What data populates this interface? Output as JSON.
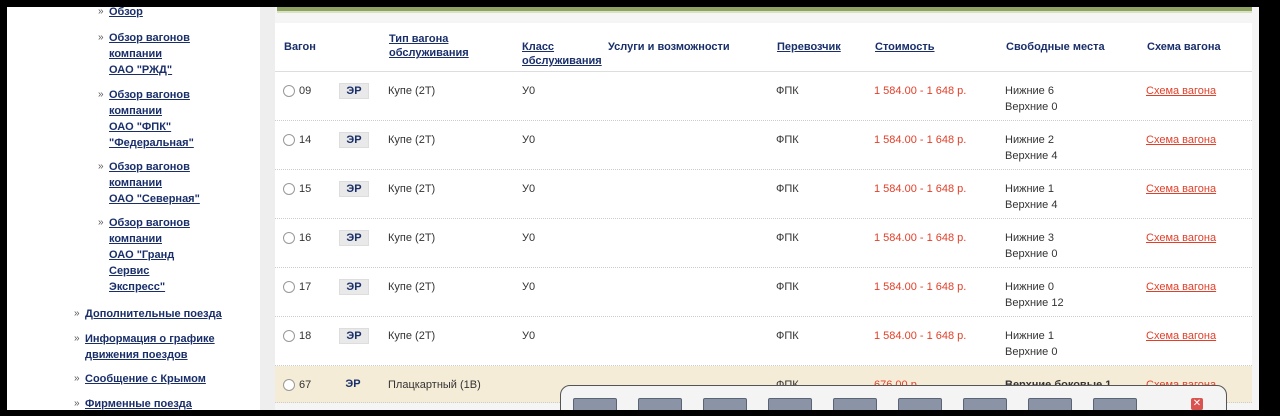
{
  "sidebar": {
    "items": [
      {
        "label": "Обзор",
        "indent": 2
      },
      {
        "label": "Обзор вагонов\nкомпании\nОАО \"РЖД\"",
        "indent": 2
      },
      {
        "label": "Обзор вагонов\nкомпании\nОАО \"ФПК\"\n\"Федеральная\"",
        "indent": 2
      },
      {
        "label": "Обзор вагонов\nкомпании\nОАО \"Северная\"",
        "indent": 2
      },
      {
        "label": "Обзор вагонов\nкомпании\nОАО \"Гранд\nСервис\nЭкспресс\"",
        "indent": 2
      },
      {
        "label": "Дополнительные поезда",
        "indent": 1
      },
      {
        "label": "Информация о графике\nдвижения поездов",
        "indent": 1
      },
      {
        "label": "Сообщение с Крымом",
        "indent": 1
      },
      {
        "label": "Фирменные поезда",
        "indent": 1
      }
    ]
  },
  "table": {
    "headers": {
      "wagon": "Вагон",
      "type": "Тип вагона\nобслуживания",
      "class": "Класс\nобслуживания",
      "services": "Услуги и возможности",
      "carrier": "Перевозчик",
      "price": "Стоимость",
      "seats": "Свободные места",
      "scheme": "Схема вагона"
    },
    "rows": [
      {
        "num": "09",
        "badge": "ЭР",
        "type": "Купе (2Т)",
        "class": "У0",
        "carrier": "ФПК",
        "price": "1 584.00 - 1 648 р.",
        "seats_top": "Нижние 6",
        "seats_bottom": "Верхние 0",
        "scheme": "Схема вагона"
      },
      {
        "num": "14",
        "badge": "ЭР",
        "type": "Купе (2Т)",
        "class": "У0",
        "carrier": "ФПК",
        "price": "1 584.00 - 1 648 р.",
        "seats_top": "Нижние 2",
        "seats_bottom": "Верхние 4",
        "scheme": "Схема вагона"
      },
      {
        "num": "15",
        "badge": "ЭР",
        "type": "Купе (2Т)",
        "class": "У0",
        "carrier": "ФПК",
        "price": "1 584.00 - 1 648 р.",
        "seats_top": "Нижние 1",
        "seats_bottom": "Верхние 4",
        "scheme": "Схема вагона"
      },
      {
        "num": "16",
        "badge": "ЭР",
        "type": "Купе (2Т)",
        "class": "У0",
        "carrier": "ФПК",
        "price": "1 584.00 - 1 648 р.",
        "seats_top": "Нижние 3",
        "seats_bottom": "Верхние 0",
        "scheme": "Схема вагона"
      },
      {
        "num": "17",
        "badge": "ЭР",
        "type": "Купе (2Т)",
        "class": "У0",
        "carrier": "ФПК",
        "price": "1 584.00 - 1 648 р.",
        "seats_top": "Нижние 0",
        "seats_bottom": "Верхние 12",
        "scheme": "Схема вагона"
      },
      {
        "num": "18",
        "badge": "ЭР",
        "type": "Купе (2Т)",
        "class": "У0",
        "carrier": "ФПК",
        "price": "1 584.00 - 1 648 р.",
        "seats_top": "Нижние 1",
        "seats_bottom": "Верхние 0",
        "scheme": "Схема вагона"
      },
      {
        "num": "67",
        "badge": "ЭР",
        "type": "Плацкартный (1В)",
        "class": "",
        "carrier": "ФПК",
        "price": "676.00 р.",
        "seats_top": "Верхние боковые 1",
        "seats_bottom": "",
        "scheme": "Схема вагона"
      }
    ]
  },
  "colors": {
    "link": "#1a2f6a",
    "price": "#e0402a",
    "accent_bar": "#8ea262",
    "selected_row": "#f5ecd7"
  },
  "toolbar": {
    "close_icon": "close-icon"
  }
}
